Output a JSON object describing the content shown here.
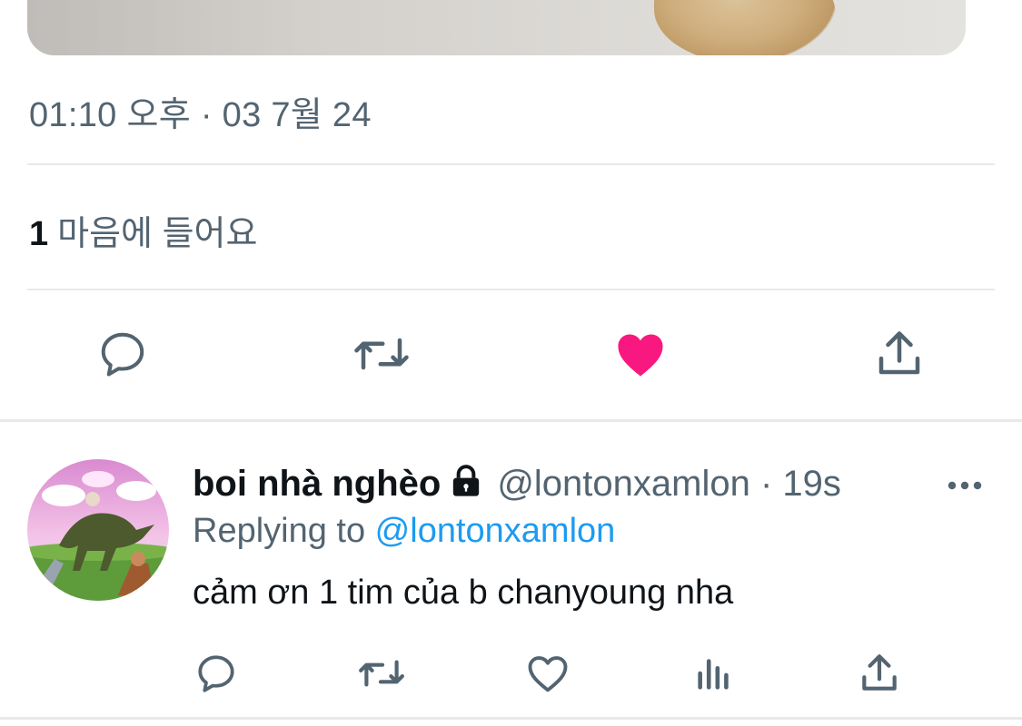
{
  "tweet": {
    "timestamp": "01:10 오후 · 03 7월 24",
    "likes_count": "1",
    "likes_label": "마음에 들어요",
    "liked": true,
    "like_color": "#f91880",
    "actions": [
      "reply-icon",
      "retweet-icon",
      "like-icon",
      "share-icon"
    ]
  },
  "reply": {
    "display_name": "boi nhà nghèo",
    "handle": "@lontonxamlon",
    "time_sep": " · ",
    "time": "19s",
    "replying_prefix": "Replying to ",
    "replying_to": "@lontonxamlon",
    "text": "cảm ơn 1 tim của b chanyoung nha",
    "actions": [
      "reply-icon",
      "retweet-icon",
      "like-icon",
      "analytics-icon",
      "share-icon"
    ]
  },
  "colors": {
    "text_primary": "#0f1419",
    "text_secondary": "#536471",
    "accent": "#1d9bf0",
    "divider": "#e7e9ea"
  }
}
